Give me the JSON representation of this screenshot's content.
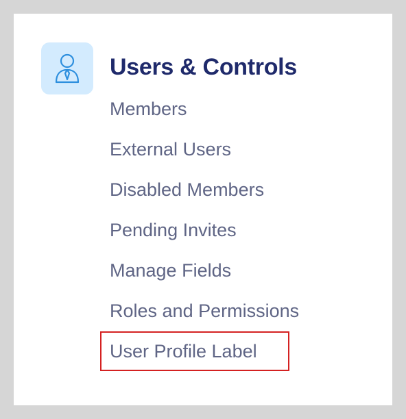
{
  "section": {
    "title": "Users & Controls",
    "icon": "user-icon",
    "accent_color": "#1f2a6b",
    "icon_tile_color": "#d3ebfe",
    "icon_stroke_color": "#2d8fde"
  },
  "menu": {
    "items": [
      {
        "label": "Members"
      },
      {
        "label": "External Users"
      },
      {
        "label": "Disabled Members"
      },
      {
        "label": "Pending Invites"
      },
      {
        "label": "Manage Fields"
      },
      {
        "label": "Roles and Permissions"
      },
      {
        "label": "User Profile Label"
      }
    ],
    "text_color": "#5f6585",
    "highlighted_item": "User Profile Label",
    "highlight_color": "#d42121"
  }
}
